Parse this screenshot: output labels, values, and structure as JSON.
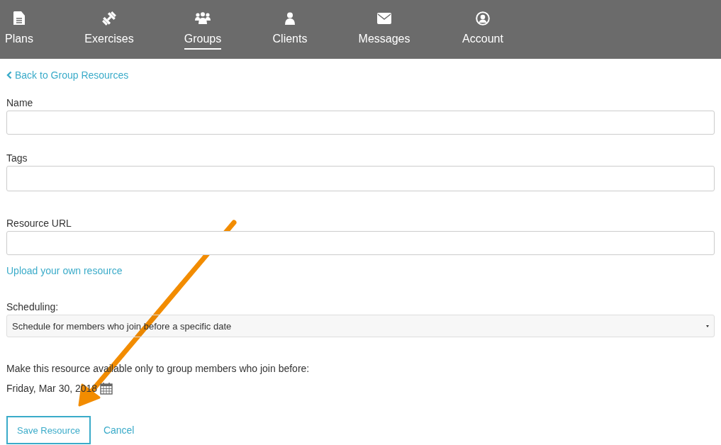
{
  "nav": [
    {
      "label": "Plans",
      "selected": false
    },
    {
      "label": "Exercises",
      "selected": false
    },
    {
      "label": "Groups",
      "selected": true
    },
    {
      "label": "Clients",
      "selected": false
    },
    {
      "label": "Messages",
      "selected": false
    },
    {
      "label": "Account",
      "selected": false
    }
  ],
  "back_link": "Back to Group Resources",
  "fields": [
    {
      "label": "Name"
    },
    {
      "label": "Tags"
    },
    {
      "label": "Resource URL"
    }
  ],
  "upload_link": "Upload your own resource",
  "scheduling": {
    "label": "Scheduling:",
    "value": "Schedule for members who join before a specific date"
  },
  "availability_note": "Make this resource available only to group members who join before:",
  "date": "Friday, Mar 30, 2018",
  "buttons": [
    {
      "label": "Save Resource",
      "kind": "outlined"
    },
    {
      "label": "Cancel",
      "kind": "link"
    }
  ]
}
